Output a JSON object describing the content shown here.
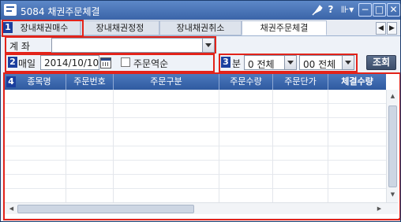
{
  "window": {
    "title": "5084 채권주문체결",
    "pin_icon": "pin-icon",
    "help_label": "?",
    "menu_label": "⊪▾",
    "min_label": "−",
    "max_label": "□",
    "close_label": "✕"
  },
  "tabs": [
    {
      "label": "장내채권매수",
      "active": false
    },
    {
      "label": "장내채권정정",
      "active": false
    },
    {
      "label": "장내채권취소",
      "active": false
    },
    {
      "label": "채권주문체결",
      "active": true
    }
  ],
  "tab_scroll": {
    "left": "◀",
    "right": "▶"
  },
  "badges": {
    "b1": "1",
    "b2": "2",
    "b3": "3",
    "b4": "4"
  },
  "account": {
    "label": "계   좌",
    "value": ""
  },
  "date_row": {
    "label": "매일",
    "date_value": "2014/10/10",
    "checkbox_label": "주문역순",
    "checked": false
  },
  "filter": {
    "label": "분",
    "select1_value": "0 전체",
    "select2_value": "00 전체",
    "query_button": "조회"
  },
  "grid": {
    "columns": [
      "종목명",
      "주문번호",
      "주문구분",
      "주문수량",
      "주문단가",
      "체결수량"
    ],
    "rows": [],
    "scroll_up": "▲",
    "scroll_down": "▼",
    "scroll_left": "◀",
    "scroll_right": "▶"
  },
  "colors": {
    "accent": "#2f5aa0",
    "highlight_border": "#e2231a",
    "badge": "#1b3f9e"
  }
}
